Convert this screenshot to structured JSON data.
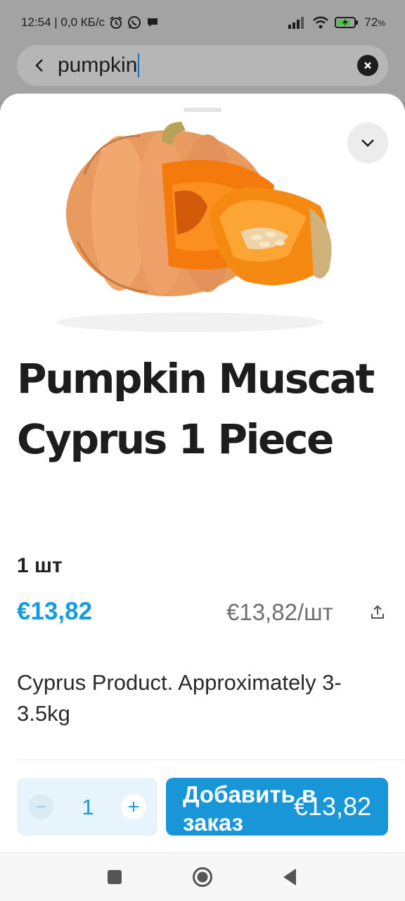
{
  "status": {
    "time_and_speed": "12:54 | 0,0 КБ/с",
    "battery": "72",
    "battery_unit": "%"
  },
  "search": {
    "query": "pumpkin"
  },
  "product": {
    "title": "Pumpkin Muscat Cyprus 1 Piece",
    "unit": "1 шт",
    "price": "€13,82",
    "unit_price": "€13,82/шт",
    "description": "Cyprus Product. Approximately 3-3.5kg",
    "quantity": "1",
    "add_label": "Добавить в заказ",
    "add_price": "€13,82"
  },
  "colors": {
    "accent": "#1896d8",
    "price": "#159be0",
    "stepper_bg": "#e8f4fb"
  },
  "icons": {
    "back": "chevron-left-icon",
    "clear": "close-circle-icon",
    "collapse": "chevron-down-icon",
    "share": "share-icon",
    "minus": "minus-icon",
    "plus": "plus-icon",
    "nav_recent": "square-icon",
    "nav_home": "circle-icon",
    "nav_back": "triangle-back-icon"
  }
}
